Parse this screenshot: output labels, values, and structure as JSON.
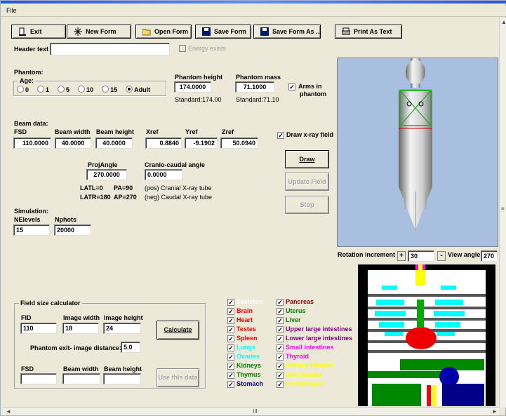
{
  "menu": {
    "file": "File"
  },
  "toolbar": {
    "exit": "Exit",
    "new_form": "New Form",
    "open_form": "Open Form",
    "save_form": "Save Form",
    "save_form_as": "Save Form As ...",
    "print_as_text": "Print As Text"
  },
  "header": {
    "label": "Header text",
    "value": "",
    "energy_label": "Energy exists"
  },
  "phantom": {
    "section": "Phantom:",
    "age_label": "Age:",
    "ages": [
      "0",
      "1",
      "5",
      "10",
      "15",
      "Adult"
    ],
    "selected_age": "Adult",
    "height_label": "Phantom height",
    "height_value": "174.0000",
    "height_standard": "Standard:174.00",
    "mass_label": "Phantom mass",
    "mass_value": "71.1000",
    "mass_standard": "Standard:71.10",
    "arms_label_1": "Arms in",
    "arms_label_2": "phantom"
  },
  "beam": {
    "section": "Beam data:",
    "fsd_label": "FSD",
    "fsd_value": "110.0000",
    "width_label": "Beam width",
    "width_value": "40.0000",
    "height_label": "Beam height",
    "height_value": "40.0000",
    "xref_label": "Xref",
    "xref_value": "0.8840",
    "yref_label": "Yref",
    "yref_value": "-9.1902",
    "zref_label": "Zref",
    "zref_value": "50.0940",
    "draw_xray_label": "Draw x-ray field",
    "proj_label": "ProjAngle",
    "proj_value": "270.0000",
    "cc_label": "Cranio-caudal angle",
    "cc_value": "0.0000",
    "note_latl": "LATL=0",
    "note_pa": "PA=90",
    "note_latr": "LATR=180",
    "note_ap": "AP=270",
    "note_pos": "(pos) Cranial X-ray tube",
    "note_neg": "(neg) Caudal X-ray tube"
  },
  "actions": {
    "draw": "Draw",
    "update_field": "Update Field",
    "stop": "Stop"
  },
  "simulation": {
    "section": "Simulation:",
    "nelevels_label": "NElevels",
    "nelevels_value": "15",
    "nphots_label": "Nphots",
    "nphots_value": "20000"
  },
  "view": {
    "rotation_label": "Rotation increment",
    "rotation_value": "30",
    "angle_label": "View angle",
    "angle_value": "270"
  },
  "calculator": {
    "title": "Field size calculator",
    "fid_label": "FID",
    "fid_value": "110",
    "iw_label": "Image width",
    "iw_value": "18",
    "ih_label": "Image height",
    "ih_value": "24",
    "calculate": "Calculate",
    "exit_dist_label": "Phantom exit- image distance:",
    "exit_dist_value": "5.0",
    "fsd_label": "FSD",
    "fsd_value": "",
    "bw_label": "Beam width",
    "bw_value": "",
    "bh_label": "Beam height",
    "bh_value": "",
    "use_data": "Use this data"
  },
  "organs_left": [
    {
      "name": "Skeleton",
      "color": "#ffffff"
    },
    {
      "name": "Brain",
      "color": "#ff0000"
    },
    {
      "name": "Heart",
      "color": "#ff0000"
    },
    {
      "name": "Testes",
      "color": "#ff0000"
    },
    {
      "name": "Spleen",
      "color": "#ff0000"
    },
    {
      "name": "Lungs",
      "color": "#00ffff"
    },
    {
      "name": "Ovaries",
      "color": "#00ffff"
    },
    {
      "name": "Kidneys",
      "color": "#008000"
    },
    {
      "name": "Thymus",
      "color": "#008000"
    },
    {
      "name": "Stomach",
      "color": "#000080"
    }
  ],
  "organs_right": [
    {
      "name": "Pancreas",
      "color": "#800000"
    },
    {
      "name": "Uterus",
      "color": "#008000"
    },
    {
      "name": "Liver",
      "color": "#008000"
    },
    {
      "name": "Upper large intestines",
      "color": "#800080"
    },
    {
      "name": "Lower large intestines",
      "color": "#800080"
    },
    {
      "name": "Small intestines",
      "color": "#ff00ff"
    },
    {
      "name": "Thyroid",
      "color": "#ff00ff"
    },
    {
      "name": "Urinary Bladder",
      "color": "#ffff00"
    },
    {
      "name": "Gall bladder",
      "color": "#ffff00"
    },
    {
      "name": "Oesophagus",
      "color": "#ffff00"
    }
  ],
  "scroll": {
    "h_thumb": "III"
  }
}
